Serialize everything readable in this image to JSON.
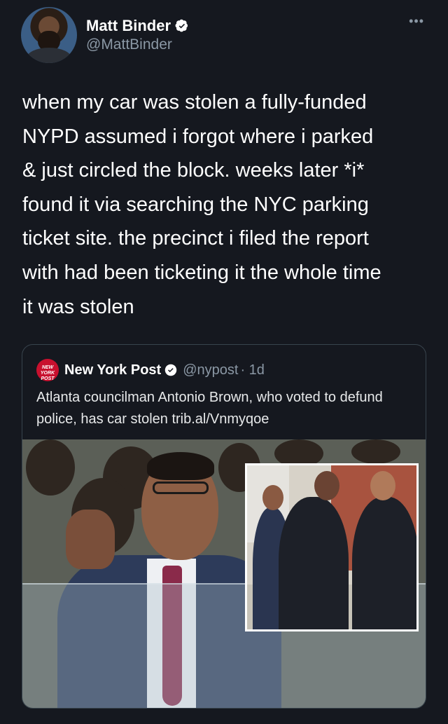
{
  "tweet": {
    "author_name": "Matt Binder",
    "author_handle": "@MattBinder",
    "more_label": "•••",
    "text": "when my car was stolen a fully-funded\nNYPD assumed i forgot where i parked\n& just circled the block. weeks later *i*\nfound it via searching the NYC parking\nticket site. the precinct i filed the report\nwith had been ticketing it the whole time\nit was stolen"
  },
  "quote": {
    "logo_text": "NEW YORK POST",
    "author_name": "New York Post",
    "author_handle": "@nypost",
    "timestamp": "· 1d",
    "text": "Atlanta councilman Antonio Brown, who voted to defund police, has car stolen trib.al/Vnmyqoe"
  },
  "colors": {
    "background": "#15181f",
    "verified_badge": "#ffffff",
    "muted_text": "#8b98a5",
    "nypost_red": "#c8102e"
  },
  "icons": {
    "verified": "verified-badge-icon",
    "more": "more-icon"
  }
}
